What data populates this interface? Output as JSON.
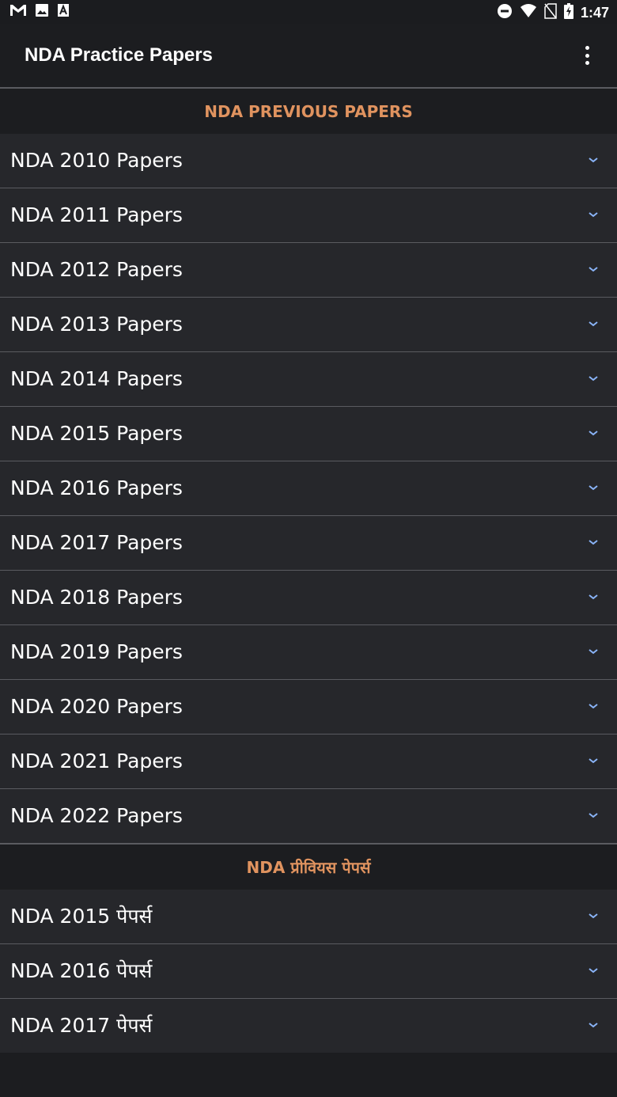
{
  "status_bar": {
    "time": "1:47",
    "left_icons": [
      "gmail-icon",
      "image-icon",
      "app-a-icon"
    ],
    "right_icons": [
      "do-not-disturb-icon",
      "wifi-icon",
      "no-sim-icon",
      "battery-charging-icon"
    ]
  },
  "app_bar": {
    "title": "NDA Practice Papers",
    "overflow_icon": "more-vert-icon"
  },
  "sections": [
    {
      "header": "NDA PREVIOUS PAPERS",
      "items": [
        "NDA 2010 Papers",
        "NDA 2011 Papers",
        "NDA 2012 Papers",
        "NDA 2013 Papers",
        "NDA 2014 Papers",
        "NDA 2015 Papers",
        "NDA 2016 Papers",
        "NDA 2017 Papers",
        "NDA 2018 Papers",
        "NDA 2019 Papers",
        "NDA 2020 Papers",
        "NDA 2021 Papers",
        "NDA 2022 Papers"
      ]
    },
    {
      "header": "NDA प्रीवियस पेपर्स",
      "items": [
        "NDA 2015 पेपर्स",
        "NDA 2016 पेपर्स",
        "NDA 2017 पेपर्स"
      ]
    }
  ],
  "colors": {
    "background": "#1c1d20",
    "row_background": "#26272b",
    "divider": "#5a5b60",
    "section_header_text": "#e0935f",
    "chevron": "#8ab4f8"
  }
}
